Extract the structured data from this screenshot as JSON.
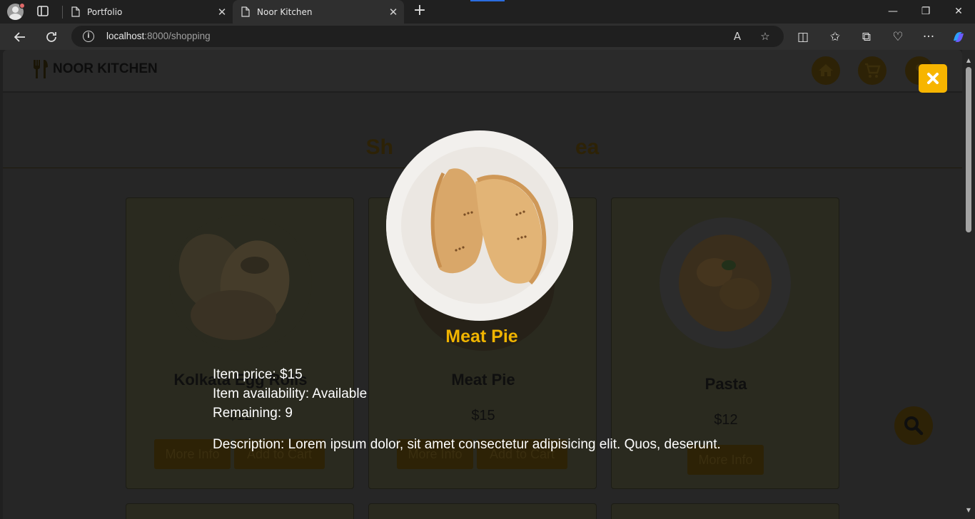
{
  "browser": {
    "tabs": [
      {
        "label": "Portfolio",
        "active": false
      },
      {
        "label": "Noor Kitchen",
        "active": true
      }
    ],
    "new_tab": "+",
    "url_host": "localhost",
    "url_rest": ":8000/shopping",
    "window_controls": {
      "minimize": "—",
      "restore": "❐",
      "close": "✕"
    }
  },
  "site": {
    "logo_text": "NOOR KITCHEN",
    "section_title": "Sh",
    "section_title_tail": "ea",
    "accent_color": "#f7b500"
  },
  "cards": [
    {
      "name": "Kolkata Egg Rolls",
      "price": "$12",
      "more_info": "More Info",
      "add_to_cart": "Add to Cart"
    },
    {
      "name": "Meat Pie",
      "price": "$15",
      "more_info": "More Info",
      "add_to_cart": "Add to Cart"
    },
    {
      "name": "Pasta",
      "price": "$12",
      "more_info": "More Info"
    }
  ],
  "modal": {
    "title": "Meat Pie",
    "price_line": "Item price: $15",
    "availability_line": "Item availability: Available",
    "remaining_line": "Remaining: 9",
    "description_line": "Description: Lorem ipsum dolor, sit amet consectetur adipisicing elit. Quos, deserunt.",
    "close_icon": "close-icon"
  }
}
